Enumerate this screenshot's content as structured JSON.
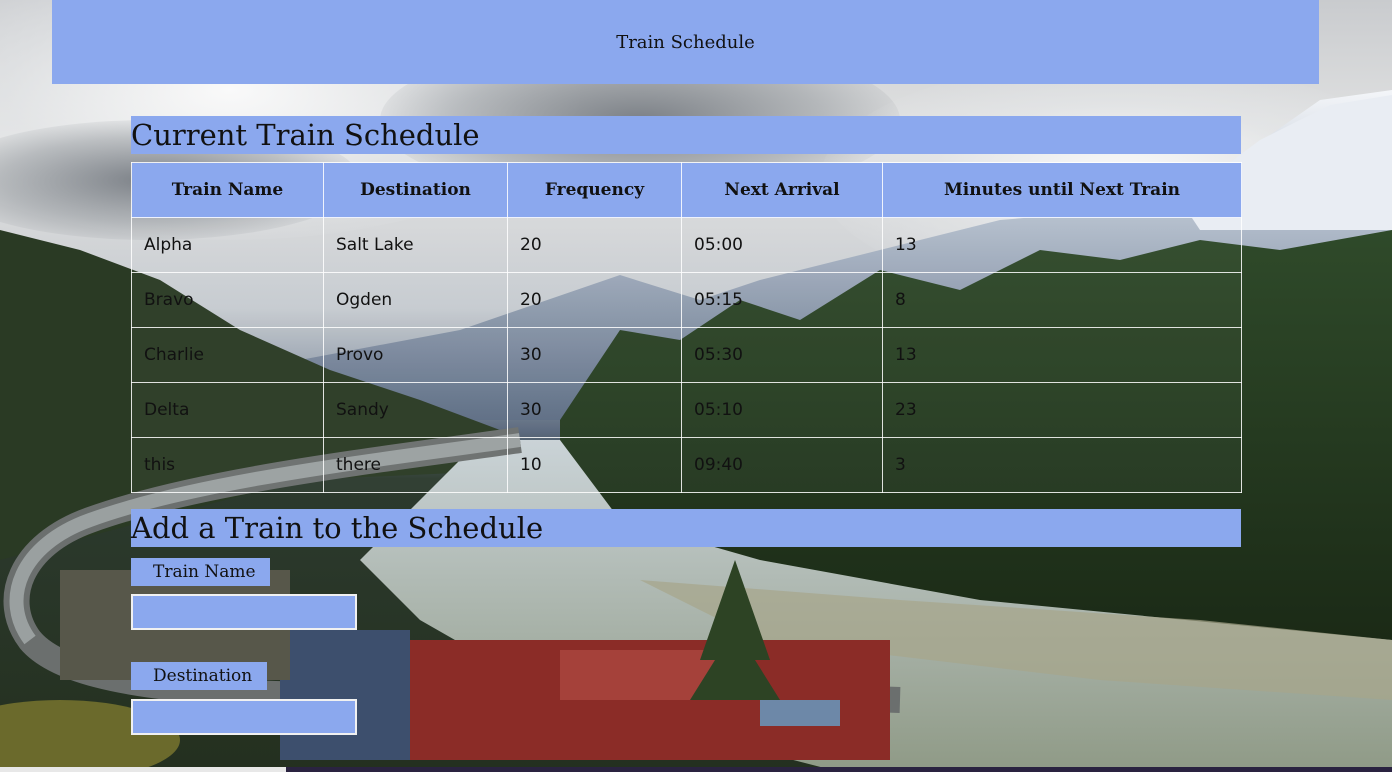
{
  "header": {
    "title": "Train Schedule"
  },
  "schedule_section": {
    "heading": "Current Train Schedule",
    "columns": [
      "Train Name",
      "Destination",
      "Frequency",
      "Next Arrival",
      "Minutes until Next Train"
    ],
    "rows": [
      [
        "Alpha",
        "Salt Lake",
        "20",
        "05:00",
        "13"
      ],
      [
        "Bravo",
        "Ogden",
        "20",
        "05:15",
        "8"
      ],
      [
        "Charlie",
        "Provo",
        "30",
        "05:30",
        "13"
      ],
      [
        "Delta",
        "Sandy",
        "30",
        "05:10",
        "23"
      ],
      [
        "this",
        "there",
        "10",
        "09:40",
        "3"
      ]
    ]
  },
  "add_section": {
    "heading": "Add a Train to the Schedule",
    "fields": [
      {
        "label": "Train Name",
        "value": ""
      },
      {
        "label": "Destination",
        "value": ""
      }
    ]
  },
  "colors": {
    "accent": "#8ba8ee",
    "text": "#111111",
    "border": "#ffffff"
  }
}
